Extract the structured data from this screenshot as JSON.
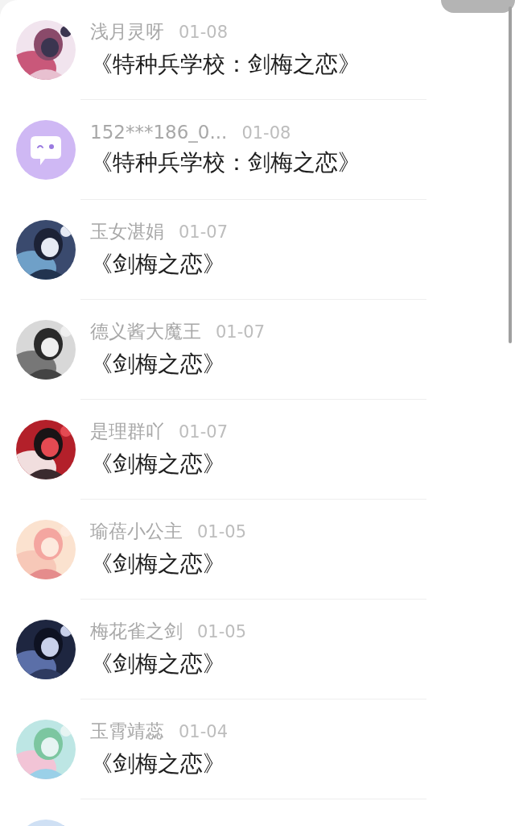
{
  "rows": [
    {
      "avatar": {
        "kind": "picture"
      },
      "name": "浅月灵呀",
      "date": "01-08",
      "title": "《特种兵学校：剑梅之恋》"
    },
    {
      "avatar": {
        "kind": "default"
      },
      "name": "152***186_0...",
      "date": "01-08",
      "title": "《特种兵学校：剑梅之恋》"
    },
    {
      "avatar": {
        "kind": "picture"
      },
      "name": "玉女湛娟",
      "date": "01-07",
      "title": "《剑梅之恋》"
    },
    {
      "avatar": {
        "kind": "picture"
      },
      "name": "德义酱大魔王",
      "date": "01-07",
      "title": "《剑梅之恋》"
    },
    {
      "avatar": {
        "kind": "picture"
      },
      "name": "是理群吖",
      "date": "01-07",
      "title": "《剑梅之恋》"
    },
    {
      "avatar": {
        "kind": "picture"
      },
      "name": "瑜蓓小公主",
      "date": "01-05",
      "title": "《剑梅之恋》"
    },
    {
      "avatar": {
        "kind": "picture"
      },
      "name": "梅花雀之剑",
      "date": "01-05",
      "title": "《剑梅之恋》"
    },
    {
      "avatar": {
        "kind": "picture"
      },
      "name": "玉霄靖蕊",
      "date": "01-04",
      "title": "《剑梅之恋》"
    },
    {
      "avatar": {
        "kind": "picture"
      }
    }
  ]
}
